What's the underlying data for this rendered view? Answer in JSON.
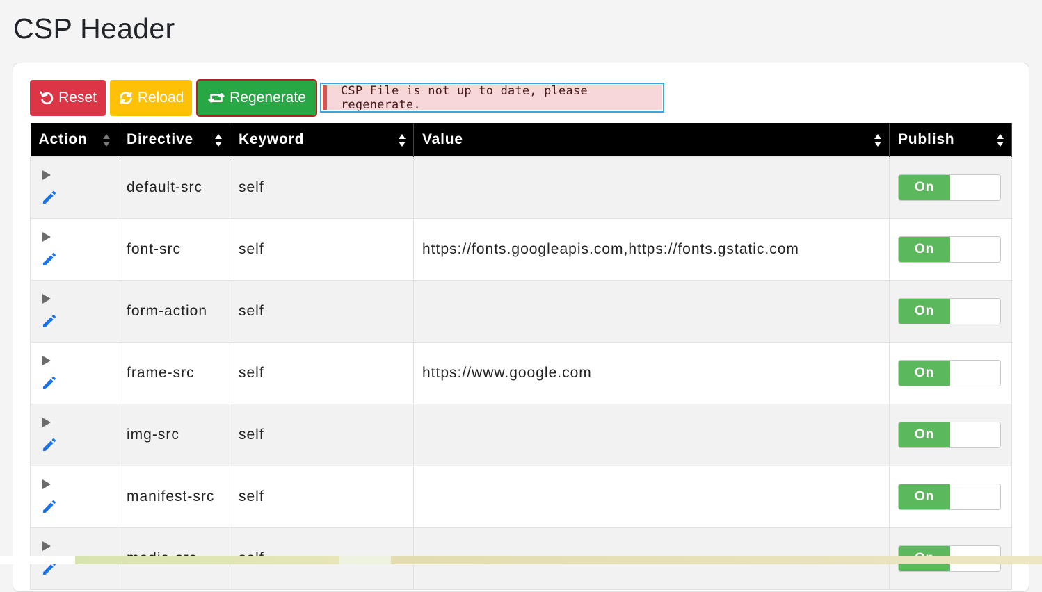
{
  "page": {
    "title": "CSP Header"
  },
  "toolbar": {
    "reset_label": "Reset",
    "reload_label": "Reload",
    "regenerate_label": "Regenerate"
  },
  "alert": {
    "message": "CSP File is not up to date, please regenerate."
  },
  "table": {
    "columns": [
      "Action",
      "Directive",
      "Keyword",
      "Value",
      "Publish"
    ],
    "rows": [
      {
        "directive": "default-src",
        "keyword": "self",
        "value": "",
        "publish": "On"
      },
      {
        "directive": "font-src",
        "keyword": "self",
        "value": "https://fonts.googleapis.com,https://fonts.gstatic.com",
        "publish": "On"
      },
      {
        "directive": "form-action",
        "keyword": "self",
        "value": "",
        "publish": "On"
      },
      {
        "directive": "frame-src",
        "keyword": "self",
        "value": "https://www.google.com",
        "publish": "On"
      },
      {
        "directive": "img-src",
        "keyword": "self",
        "value": "",
        "publish": "On"
      },
      {
        "directive": "manifest-src",
        "keyword": "self",
        "value": "",
        "publish": "On"
      },
      {
        "directive": "media-src",
        "keyword": "self",
        "value": "",
        "publish": "On"
      }
    ]
  },
  "colors": {
    "reset": "#dc3545",
    "reload": "#ffc107",
    "regenerate": "#28a745",
    "toggle_on": "#5cb85c",
    "edit_icon": "#1a73e8"
  },
  "icons": {
    "reset": "undo-icon",
    "reload": "refresh-icon",
    "regenerate": "retweet-icon",
    "expand": "caret-right-icon",
    "edit": "pencil-icon",
    "sort": "sort-icon"
  }
}
